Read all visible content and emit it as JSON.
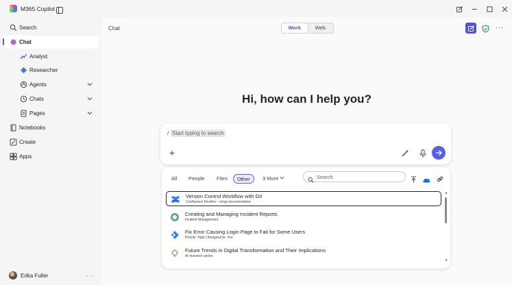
{
  "app": {
    "title": "M365 Copilot"
  },
  "sidebar": {
    "search_label": "Search",
    "items": [
      {
        "label": "Chat"
      },
      {
        "label": "Analyst"
      },
      {
        "label": "Researcher"
      },
      {
        "label": "Agents"
      },
      {
        "label": "Chats"
      },
      {
        "label": "Pages"
      },
      {
        "label": "Notebooks"
      },
      {
        "label": "Create"
      },
      {
        "label": "Apps"
      }
    ],
    "user": {
      "name": "Erika Fuller",
      "more": "···"
    }
  },
  "header": {
    "breadcrumb": "Chat",
    "toggle": {
      "work": "Work",
      "web": "Web",
      "selected": "Work"
    },
    "more": "···"
  },
  "greeting": "Hi, how can I help you?",
  "composer": {
    "slash": "/",
    "query": "Start typing to search"
  },
  "results": {
    "filters": [
      "All",
      "People",
      "Files",
      "Other",
      "3 More"
    ],
    "selected_filter": "Other",
    "search_placeholder": "Search",
    "items": [
      {
        "title": "Version Control Workflow with Git",
        "subtitle": "Confluence DevRev - setup documentation",
        "icon": "confluence-icon"
      },
      {
        "title": "Creating and Managing Incident Reports",
        "subtitle": "Incident Management",
        "icon": "incident-icon"
      },
      {
        "title": "Fix Error Causing Login Page to Fail for Some Users",
        "subtitle": "Priority: High | Assigned to: You",
        "icon": "jira-icon"
      },
      {
        "title": "Future Trends in Digital Transformation and Their Implications",
        "subtitle": "AI research series",
        "icon": "lightbulb-icon"
      }
    ]
  },
  "colors": {
    "accent": "#5b5fe8",
    "active_bar": "#6153d6",
    "shield": "#2e9e4f"
  }
}
